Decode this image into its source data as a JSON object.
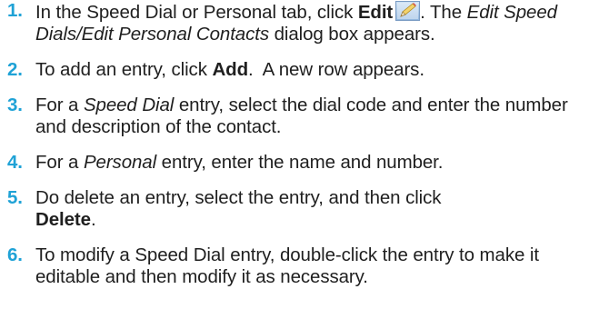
{
  "steps": [
    {
      "number": "1.",
      "parts": {
        "a": "In the Speed Dial or Personal tab, click ",
        "b": "Edit",
        "c": ". The ",
        "d": "Edit Speed Dials/Edit Personal Contacts",
        "e": " dialog box appears."
      },
      "icon": "edit-pencil-icon"
    },
    {
      "number": "2.",
      "parts": {
        "a": "To add an entry, click ",
        "b": "Add",
        "c": ".  A new row appears."
      }
    },
    {
      "number": "3.",
      "parts": {
        "a": "For a ",
        "b": "Speed Dial",
        "c": " entry, select the dial code and enter the number and description of the contact."
      }
    },
    {
      "number": "4.",
      "parts": {
        "a": "For a ",
        "b": "Personal",
        "c": " entry, enter the name and number."
      }
    },
    {
      "number": "5.",
      "parts": {
        "a": "Do delete an entry, select the entry, and then click ",
        "b": "Delete",
        "c": "."
      }
    },
    {
      "number": "6.",
      "parts": {
        "a": "To modify a Speed Dial entry, double-click the entry to make it editable and then modify it as necessary."
      }
    }
  ],
  "colors": {
    "step_number": "#1fa2d6",
    "text": "#1f1f1f"
  }
}
